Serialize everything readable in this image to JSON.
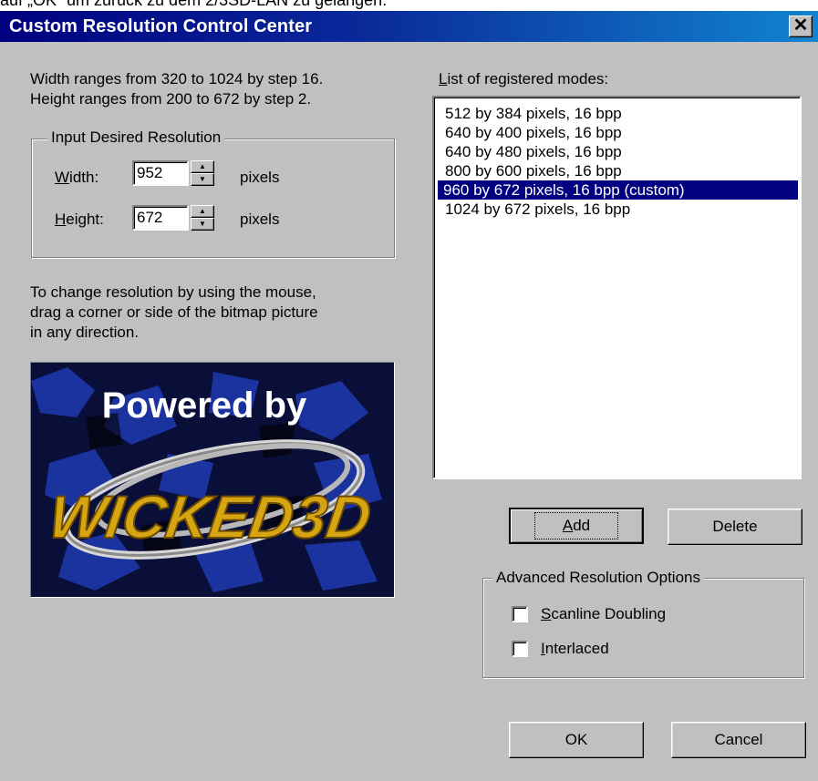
{
  "top_strip_text": "auf „OK“ um zurück zu dem 2/3SD-LAN zu gelangen.",
  "window": {
    "title": "Custom Resolution Control Center",
    "close_glyph": "✕"
  },
  "info": {
    "width_range": "Width ranges from 320 to 1024 by step 16.",
    "height_range": "Height ranges from  200 to 672 by step 2."
  },
  "resolution_group": {
    "legend": "Input  Desired  Resolution",
    "width_label_u": "W",
    "width_label_rest": "idth:",
    "width_value": "952",
    "height_label_u": "H",
    "height_label_rest": "eight:",
    "height_value": "672",
    "unit": "pixels"
  },
  "instructions": [
    "To change resolution by using the mouse,",
    "drag a corner or side of the bitmap picture",
    "in any direction."
  ],
  "bitmap": {
    "line1": "Powered by",
    "line2": "WICKED3D"
  },
  "modes": {
    "label_u": "L",
    "label_rest": "ist of registered modes:",
    "items": [
      "512 by 384 pixels,  16 bpp",
      "640 by 400 pixels,  16 bpp",
      "640 by 480 pixels,  16 bpp",
      "800 by 600 pixels,  16 bpp",
      "960 by 672 pixels,  16 bpp (custom)",
      "1024 by 672 pixels,  16 bpp"
    ],
    "selected_index": 4
  },
  "buttons": {
    "add_u": "A",
    "add_rest": "dd",
    "delete": "Delete",
    "ok": "OK",
    "cancel": "Cancel"
  },
  "advanced": {
    "legend": "Advanced Resolution Options",
    "scanline_u": "S",
    "scanline_rest": "canline Doubling",
    "interlaced_u": "I",
    "interlaced_rest": "nterlaced",
    "scanline_checked": false,
    "interlaced_checked": false
  },
  "colors": {
    "face": "#c0c0c0",
    "title_gradient_start": "#000080",
    "title_gradient_end": "#1084d0",
    "selection": "#000080"
  }
}
